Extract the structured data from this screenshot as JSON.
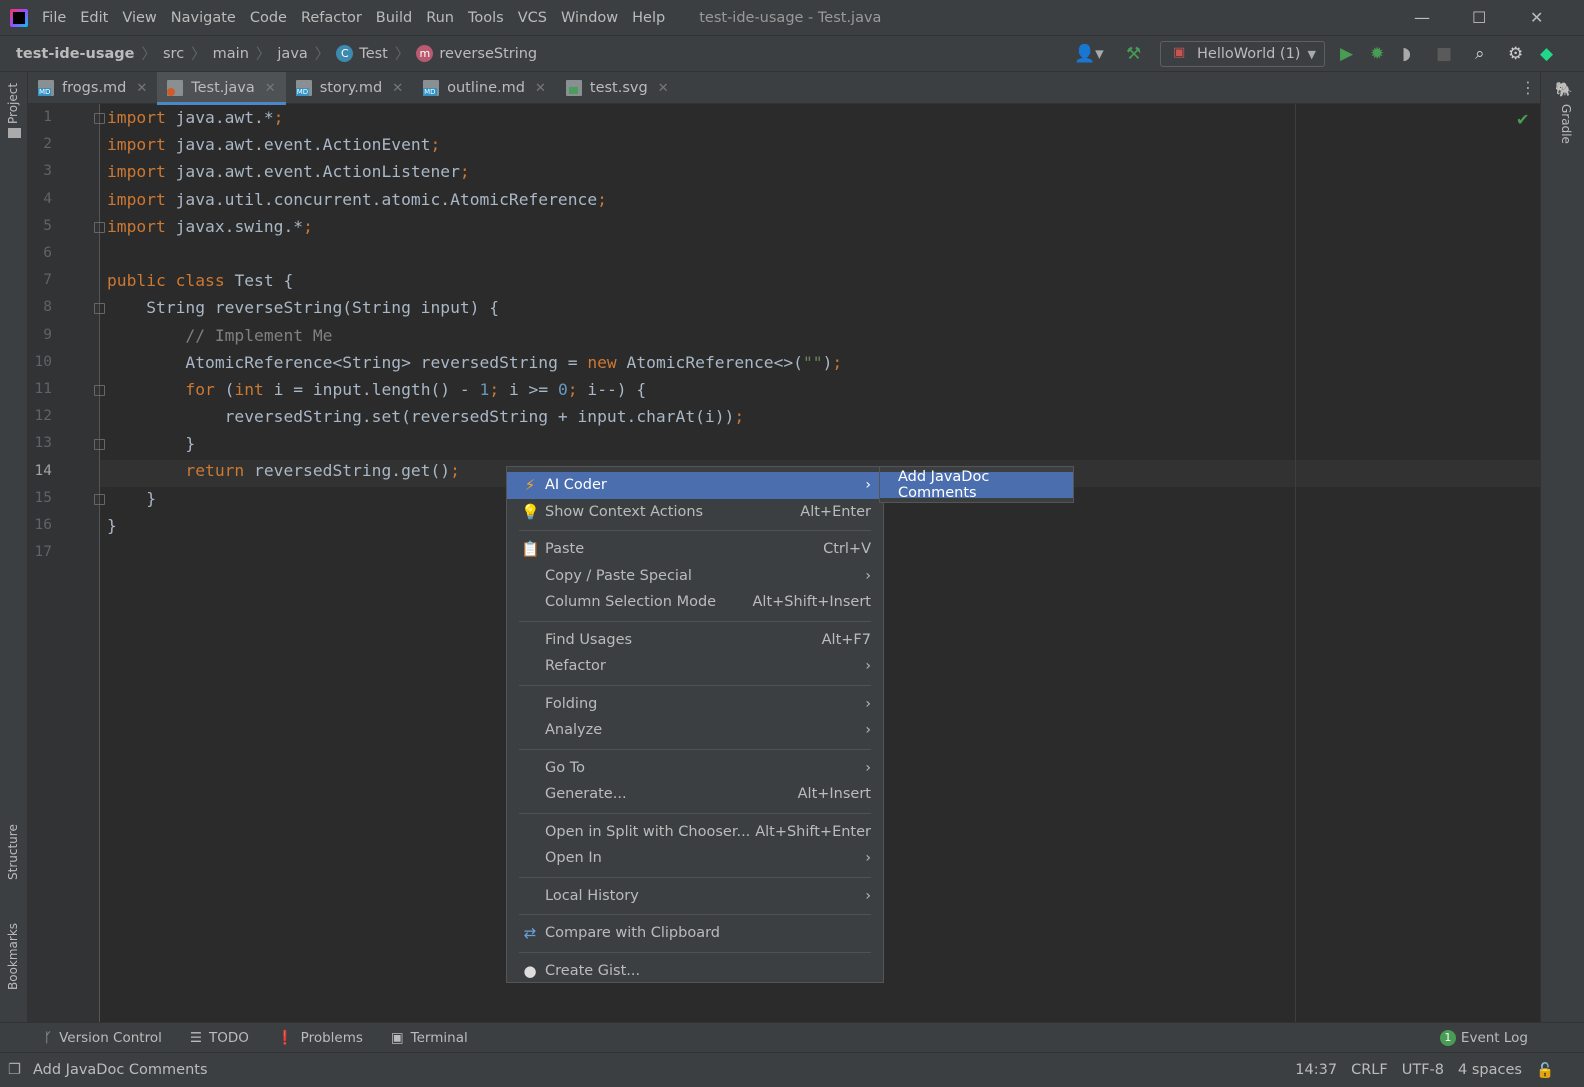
{
  "window": {
    "title": "test-ide-usage - Test.java"
  },
  "menubar": [
    "File",
    "Edit",
    "View",
    "Navigate",
    "Code",
    "Refactor",
    "Build",
    "Run",
    "Tools",
    "VCS",
    "Window",
    "Help"
  ],
  "breadcrumb": {
    "project": "test-ide-usage",
    "items": [
      "src",
      "main",
      "java"
    ],
    "class": "Test",
    "class_badge": "C",
    "method": "reverseString",
    "method_badge": "m"
  },
  "toolbar": {
    "run_config": "HelloWorld (1)"
  },
  "left_strip": {
    "project": "Project",
    "structure": "Structure",
    "bookmarks": "Bookmarks"
  },
  "right_strip": {
    "gradle": "Gradle"
  },
  "tabs": [
    {
      "label": "frogs.md",
      "type": "md",
      "active": false
    },
    {
      "label": "Test.java",
      "type": "java",
      "active": true
    },
    {
      "label": "story.md",
      "type": "md",
      "active": false
    },
    {
      "label": "outline.md",
      "type": "md",
      "active": false
    },
    {
      "label": "test.svg",
      "type": "svg",
      "active": false
    }
  ],
  "editor": {
    "current_line": 14,
    "lines": [
      [
        [
          "import",
          "kw"
        ],
        [
          " java.awt.*",
          "pl"
        ],
        [
          ";",
          "kw"
        ]
      ],
      [
        [
          "import",
          "kw"
        ],
        [
          " java.awt.event.ActionEvent",
          "pl"
        ],
        [
          ";",
          "kw"
        ]
      ],
      [
        [
          "import",
          "kw"
        ],
        [
          " java.awt.event.ActionListener",
          "pl"
        ],
        [
          ";",
          "kw"
        ]
      ],
      [
        [
          "import",
          "kw"
        ],
        [
          " java.util.concurrent.atomic.AtomicReference",
          "pl"
        ],
        [
          ";",
          "kw"
        ]
      ],
      [
        [
          "import",
          "kw"
        ],
        [
          " javax.swing.*",
          "pl"
        ],
        [
          ";",
          "kw"
        ]
      ],
      [],
      [
        [
          "public class ",
          "kw"
        ],
        [
          "Test {",
          "pl"
        ]
      ],
      [
        [
          "    String reverseString(String input) {",
          "pl"
        ]
      ],
      [
        [
          "        // Implement Me",
          "cm"
        ]
      ],
      [
        [
          "        AtomicReference<String> reversedString = ",
          "pl"
        ],
        [
          "new ",
          "kw"
        ],
        [
          "AtomicReference<>(",
          "pl"
        ],
        [
          "\"\"",
          "str"
        ],
        [
          ")",
          "pl"
        ],
        [
          ";",
          "kw"
        ]
      ],
      [
        [
          "        ",
          "pl"
        ],
        [
          "for ",
          "kw"
        ],
        [
          "(",
          "pl"
        ],
        [
          "int ",
          "kw"
        ],
        [
          "i = input.length() - ",
          "pl"
        ],
        [
          "1",
          "num"
        ],
        [
          "; ",
          "kw"
        ],
        [
          "i >= ",
          "pl"
        ],
        [
          "0",
          "num"
        ],
        [
          "; ",
          "kw"
        ],
        [
          "i--) {",
          "pl"
        ]
      ],
      [
        [
          "            reversedString.set(reversedString + input.charAt(i))",
          "pl"
        ],
        [
          ";",
          "kw"
        ]
      ],
      [
        [
          "        }",
          "pl"
        ]
      ],
      [
        [
          "        ",
          "pl"
        ],
        [
          "return ",
          "kw"
        ],
        [
          "reversedString.get()",
          "pl"
        ],
        [
          ";",
          "kw"
        ]
      ],
      [
        [
          "    }",
          "pl"
        ]
      ],
      [
        [
          "}",
          "pl"
        ]
      ],
      []
    ]
  },
  "context_menu": {
    "items": [
      {
        "label": "AI Coder",
        "icon": "lightning-icon",
        "submenu": true,
        "selected": true
      },
      {
        "label": "Show Context Actions",
        "icon": "lightbulb-icon",
        "shortcut": "Alt+Enter"
      },
      {
        "sep": true
      },
      {
        "label": "Paste",
        "icon": "clipboard-icon",
        "shortcut": "Ctrl+V"
      },
      {
        "label": "Copy / Paste Special",
        "submenu": true
      },
      {
        "label": "Column Selection Mode",
        "shortcut": "Alt+Shift+Insert"
      },
      {
        "sep": true
      },
      {
        "label": "Find Usages",
        "shortcut": "Alt+F7"
      },
      {
        "label": "Refactor",
        "submenu": true
      },
      {
        "sep": true
      },
      {
        "label": "Folding",
        "submenu": true
      },
      {
        "label": "Analyze",
        "submenu": true
      },
      {
        "sep": true
      },
      {
        "label": "Go To",
        "submenu": true
      },
      {
        "label": "Generate...",
        "shortcut": "Alt+Insert"
      },
      {
        "sep": true
      },
      {
        "label": "Open in Split with Chooser...",
        "shortcut": "Alt+Shift+Enter"
      },
      {
        "label": "Open In",
        "submenu": true
      },
      {
        "sep": true
      },
      {
        "label": "Local History",
        "submenu": true
      },
      {
        "sep": true
      },
      {
        "label": "Compare with Clipboard",
        "icon": "compare-icon"
      },
      {
        "sep": true
      },
      {
        "label": "Create Gist...",
        "icon": "github-icon"
      }
    ],
    "submenu": {
      "label": "Add JavaDoc Comments"
    }
  },
  "bottom_tools": [
    {
      "label": "Version Control",
      "icon": "branch-icon"
    },
    {
      "label": "TODO",
      "icon": "list-icon"
    },
    {
      "label": "Problems",
      "icon": "warning-icon"
    },
    {
      "label": "Terminal",
      "icon": "terminal-icon"
    }
  ],
  "event_log": {
    "label": "Event Log",
    "count": "1"
  },
  "status": {
    "message": "Add JavaDoc Comments",
    "position": "14:37",
    "line_sep": "CRLF",
    "encoding": "UTF-8",
    "indent": "4 spaces"
  },
  "colors": {
    "accent": "#4b6eaf",
    "keyword": "#cc7832",
    "text": "#a9b7c6",
    "comment": "#808080",
    "number": "#6897bb",
    "string": "#6a8759",
    "run": "#499c54"
  }
}
